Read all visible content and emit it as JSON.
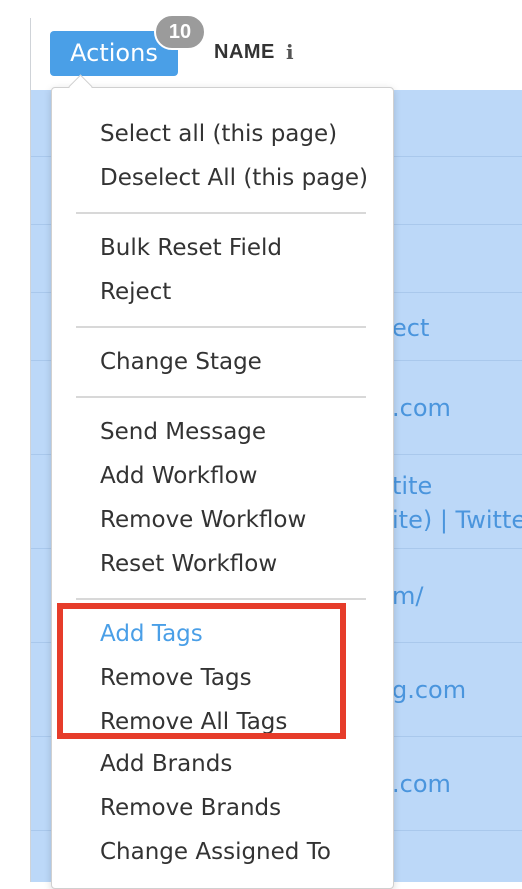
{
  "toolbar": {
    "actions_label": "Actions",
    "selected_count": "10",
    "name_column": "NAME",
    "info_glyph": "i"
  },
  "table": {
    "cell_fragments": [
      "ect",
      ".com",
      "tite",
      "ite) | Twitte",
      "m/",
      "g.com",
      ".com"
    ]
  },
  "menu": {
    "select_all": "Select all (this page)",
    "deselect_all": "Deselect All (this page)",
    "bulk_reset_field": "Bulk Reset Field",
    "reject": "Reject",
    "change_stage": "Change Stage",
    "send_message": "Send Message",
    "add_workflow": "Add Workflow",
    "remove_workflow": "Remove Workflow",
    "reset_workflow": "Reset Workflow",
    "add_tags": "Add Tags",
    "remove_tags": "Remove Tags",
    "remove_all_tags": "Remove All Tags",
    "add_brands": "Add Brands",
    "remove_brands": "Remove Brands",
    "change_assigned_to": "Change Assigned To"
  },
  "colors": {
    "accent": "#4a9fe7",
    "selection_bg": "#bcd8f8",
    "highlight_annotation": "#e63c2a",
    "badge_gray": "#9b9b9b"
  },
  "icons": {
    "info": "info-icon"
  }
}
